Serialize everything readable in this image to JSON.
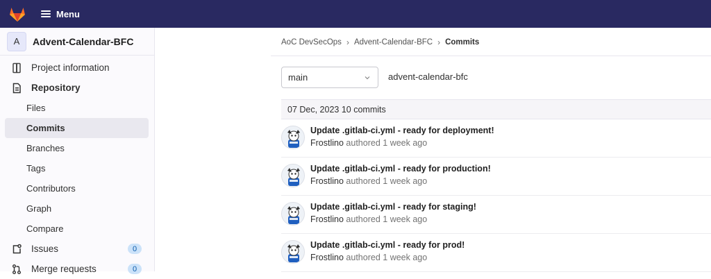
{
  "topbar": {
    "menu_label": "Menu"
  },
  "project": {
    "avatar_letter": "A",
    "name": "Advent-Calendar-BFC"
  },
  "sidebar": {
    "items": [
      {
        "label": "Project information",
        "icon": "info-icon"
      },
      {
        "label": "Repository",
        "icon": "repository-icon"
      },
      {
        "label": "Files"
      },
      {
        "label": "Commits"
      },
      {
        "label": "Branches"
      },
      {
        "label": "Tags"
      },
      {
        "label": "Contributors"
      },
      {
        "label": "Graph"
      },
      {
        "label": "Compare"
      },
      {
        "label": "Issues",
        "icon": "issues-icon",
        "badge": "0"
      },
      {
        "label": "Merge requests",
        "icon": "merge-request-icon",
        "badge": "0"
      }
    ]
  },
  "breadcrumb": {
    "group": "AoC DevSecOps",
    "project": "Advent-Calendar-BFC",
    "current": "Commits"
  },
  "branch": {
    "selected": "main",
    "path": "advent-calendar-bfc"
  },
  "day_header": "07 Dec, 2023 10 commits",
  "commits": [
    {
      "title": "Update .gitlab-ci.yml - ready for deployment!",
      "author": "Frostlino",
      "action": "authored",
      "time": "1 week ago"
    },
    {
      "title": "Update .gitlab-ci.yml - ready for production!",
      "author": "Frostlino",
      "action": "authored",
      "time": "1 week ago"
    },
    {
      "title": "Update .gitlab-ci.yml - ready for staging!",
      "author": "Frostlino",
      "action": "authored",
      "time": "1 week ago"
    },
    {
      "title": "Update .gitlab-ci.yml - ready for prod!",
      "author": "Frostlino",
      "action": "authored",
      "time": "1 week ago"
    }
  ],
  "colors": {
    "topbar": "#292961",
    "logo_orange": "#e24329",
    "badge_bg": "#cbe2f9"
  }
}
